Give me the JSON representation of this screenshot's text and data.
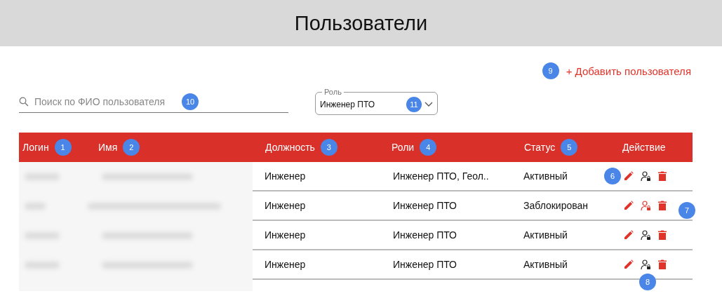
{
  "title": "Пользователи",
  "add_button": {
    "label": "+ Добавить пользователя",
    "marker": "9"
  },
  "search": {
    "placeholder": "Поиск по ФИО пользователя",
    "marker": "10"
  },
  "role_select": {
    "label": "Роль",
    "value": "Инженер ПТО",
    "marker": "11"
  },
  "columns": [
    {
      "label": "Логин",
      "marker": "1"
    },
    {
      "label": "Имя",
      "marker": "2"
    },
    {
      "label": "Должность",
      "marker": "3"
    },
    {
      "label": "Роли",
      "marker": "4"
    },
    {
      "label": "Статус",
      "marker": "5"
    },
    {
      "label": "Действие"
    }
  ],
  "rows": [
    {
      "position": "Инженер",
      "roles": "Инженер ПТО, Геол..",
      "status": "Активный",
      "blocked": false,
      "marker": {
        "label": "6",
        "kind": "before"
      }
    },
    {
      "position": "Инженер",
      "roles": "Инженер ПТО",
      "status": "Заблокирован",
      "blocked": true,
      "marker": {
        "label": "7",
        "kind": "after"
      }
    },
    {
      "position": "Инженер",
      "roles": "Инженер ПТО",
      "status": "Активный",
      "blocked": false
    },
    {
      "position": "Инженер",
      "roles": "Инженер ПТО",
      "status": "Активный",
      "blocked": false,
      "marker": {
        "label": "8",
        "kind": "below"
      }
    }
  ]
}
